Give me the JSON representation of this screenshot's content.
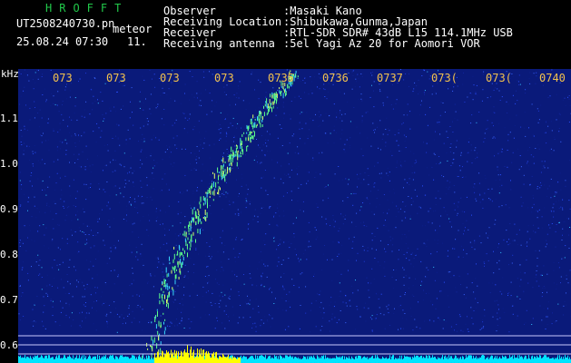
{
  "header": {
    "brand": "HROFFT",
    "filename": "UT2508240730.pn",
    "tag": "meteor",
    "datetime": "25.08.24 07:30",
    "count": "11."
  },
  "station": [
    {
      "label": "Observer",
      "value": ":Masaki Kano"
    },
    {
      "label": "Receiving Location",
      "value": ":Shibukawa,Gunma,Japan"
    },
    {
      "label": "Receiver",
      "value": ":RTL-SDR SDR# 43dB L15 114.1MHz USB"
    },
    {
      "label": "Receiving antenna",
      "value": ":5el Yagi Az 20 for Aomori VOR"
    }
  ],
  "y_axis": {
    "unit": "kHz",
    "ticks": [
      "1.1",
      "1.0",
      "0.9",
      "0.8",
      "0.7",
      "0.6"
    ]
  },
  "x_axis": {
    "ticks": [
      "073",
      "073",
      "073",
      "073",
      "0735",
      "0736",
      "0737",
      "073(",
      "073(",
      "0740"
    ]
  },
  "colors": {
    "background": "#000000",
    "spectrum": "#0a1a7a",
    "noise_floor": "#00e5ff",
    "signal": "#ffff00",
    "trace": "#5cff8a",
    "grid": "#c8c8ff",
    "brand": "#21c94a",
    "time_label": "#f2c14e"
  }
}
